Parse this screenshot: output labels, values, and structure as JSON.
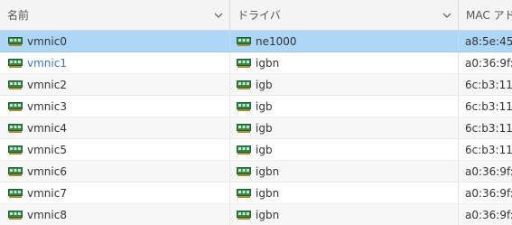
{
  "columns": {
    "name": "名前",
    "driver": "ドライバ",
    "mac": "MAC アド"
  },
  "rows": [
    {
      "name": "vmnic0",
      "driver": "ne1000",
      "mac": "a8:5e:45:"
    },
    {
      "name": "vmnic1",
      "driver": "igbn",
      "mac": "a0:36:9f:0"
    },
    {
      "name": "vmnic2",
      "driver": "igb",
      "mac": "6c:b3:11:1"
    },
    {
      "name": "vmnic3",
      "driver": "igb",
      "mac": "6c:b3:11:1"
    },
    {
      "name": "vmnic4",
      "driver": "igb",
      "mac": "6c:b3:11:1"
    },
    {
      "name": "vmnic5",
      "driver": "igb",
      "mac": "6c:b3:11:1"
    },
    {
      "name": "vmnic6",
      "driver": "igbn",
      "mac": "a0:36:9f:0"
    },
    {
      "name": "vmnic7",
      "driver": "igbn",
      "mac": "a0:36:9f:0"
    },
    {
      "name": "vmnic8",
      "driver": "igbn",
      "mac": "a0:36:9f:0"
    }
  ],
  "icons": {
    "column_menu": "chevron-down-icon",
    "nic": "network-card-icon"
  },
  "colors": {
    "selected_row": "#add6f7",
    "link_text": "#3a7ab5",
    "nic_icon": "#2f8a4a"
  }
}
